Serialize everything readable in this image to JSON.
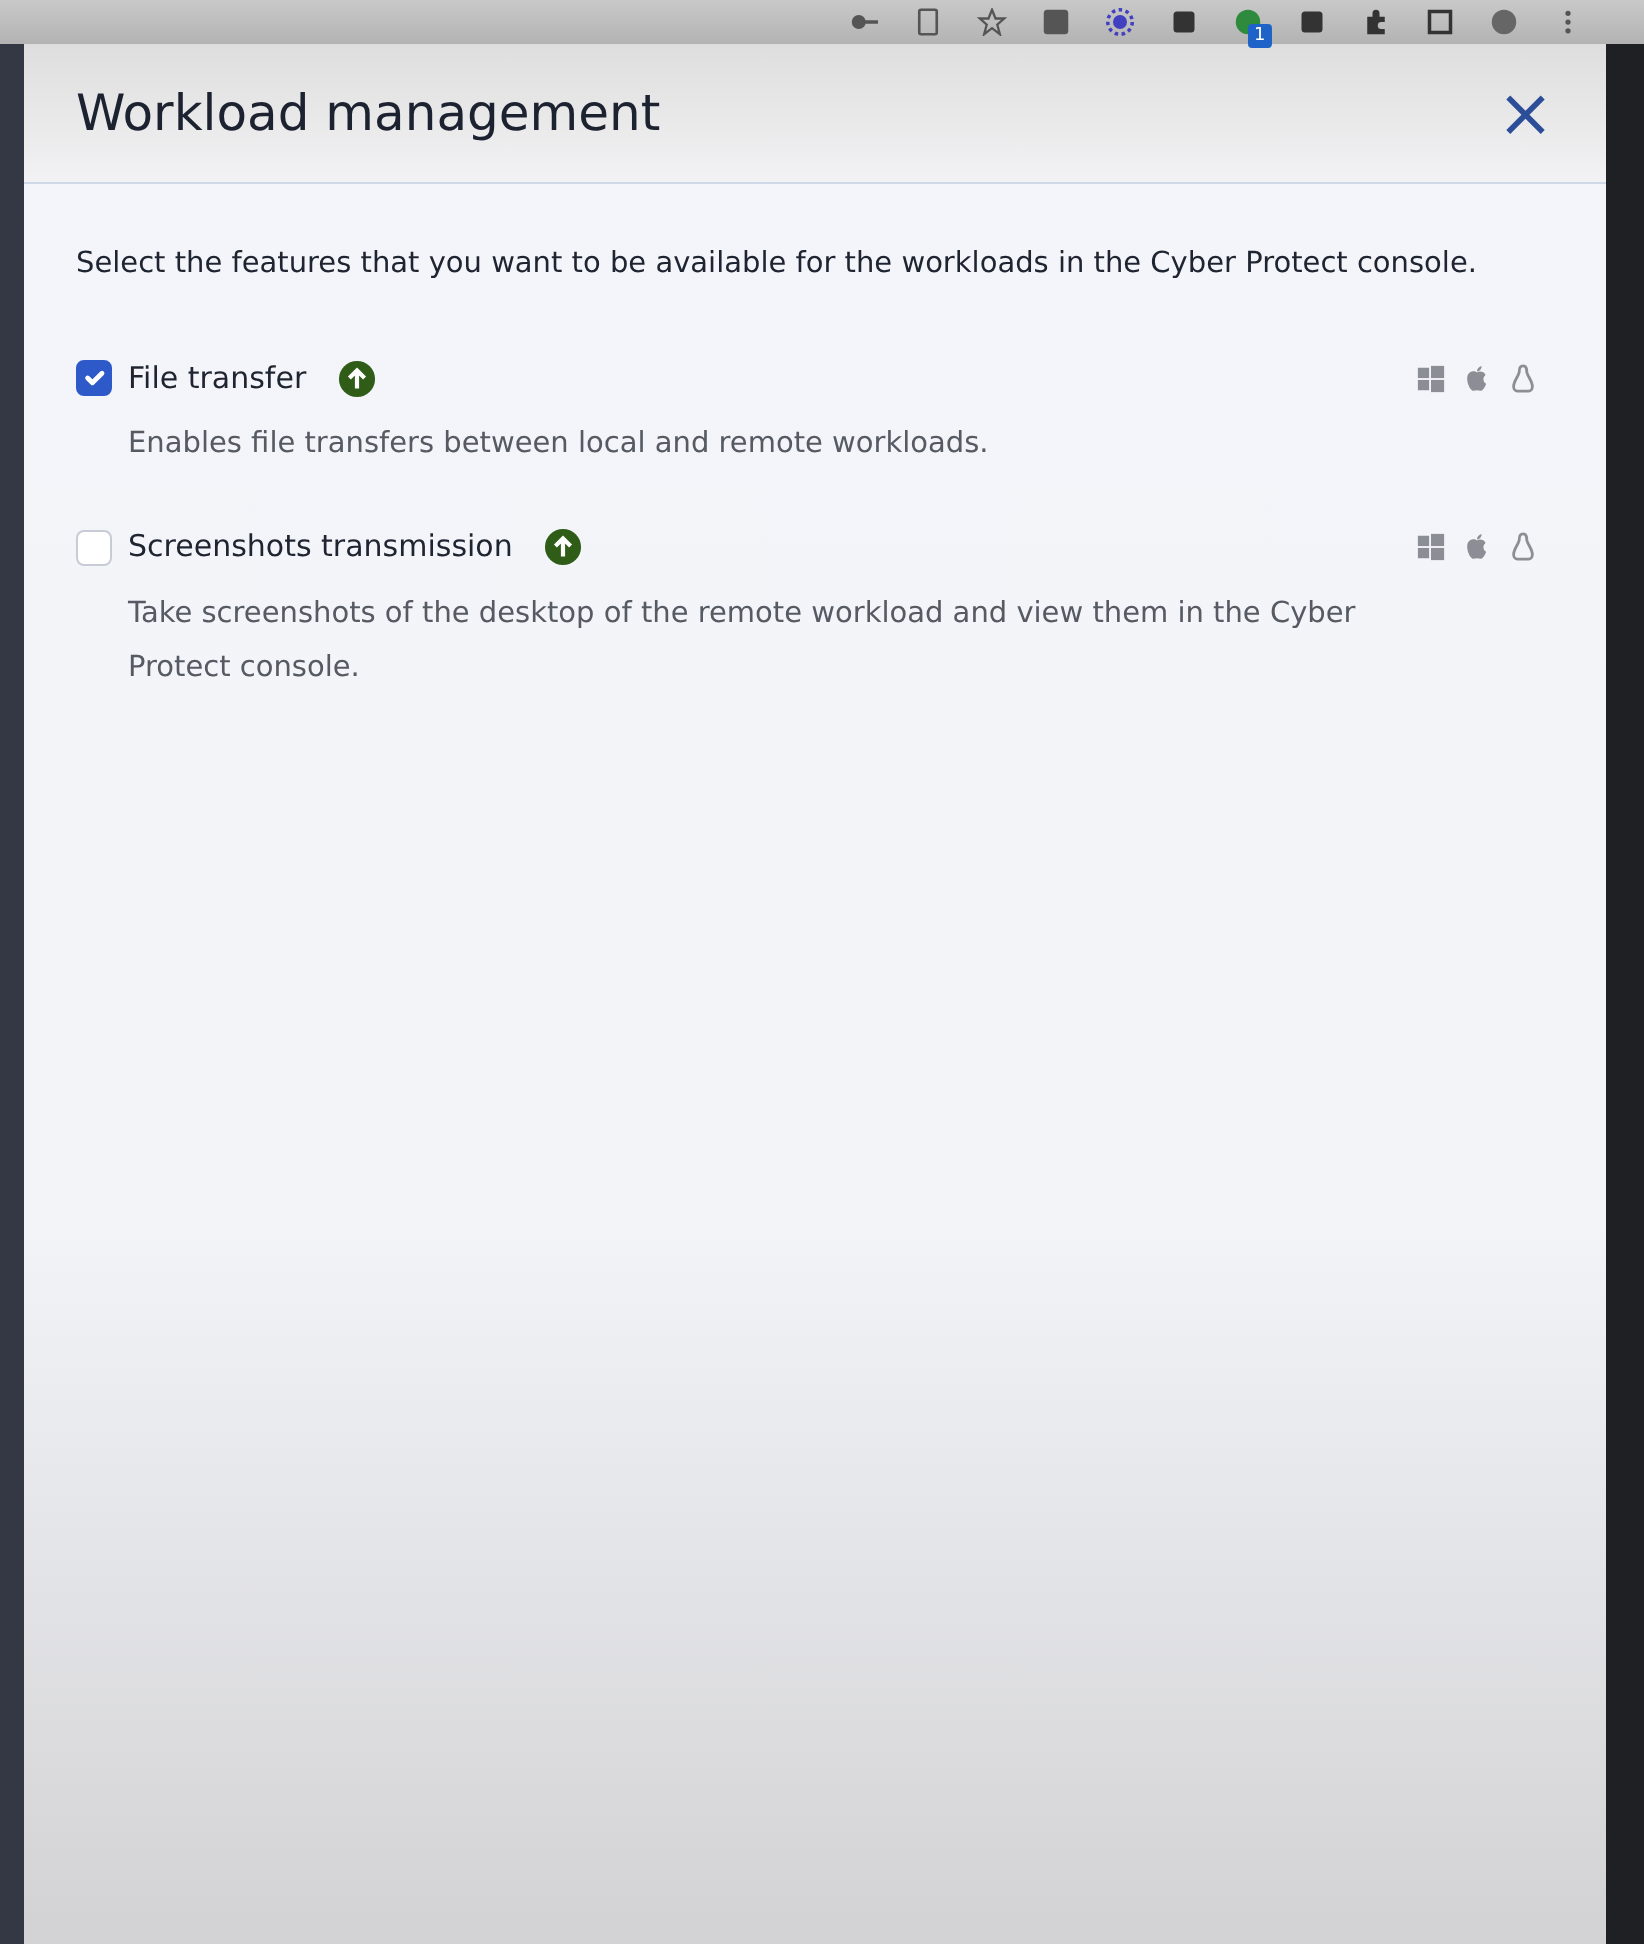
{
  "browser_toolbar": {
    "badge": "1"
  },
  "dialog": {
    "title": "Workload management",
    "close": "×"
  },
  "intro": "Select the features that you want to be available for the workloads in the Cyber Protect console.",
  "features": [
    {
      "label": "File transfer",
      "checked": true,
      "description": "Enables file transfers between local and remote workloads."
    },
    {
      "label": "Screenshots transmission",
      "checked": false,
      "description": "Take screenshots of the desktop of the remote workload and view them in the Cyber Protect console."
    }
  ]
}
